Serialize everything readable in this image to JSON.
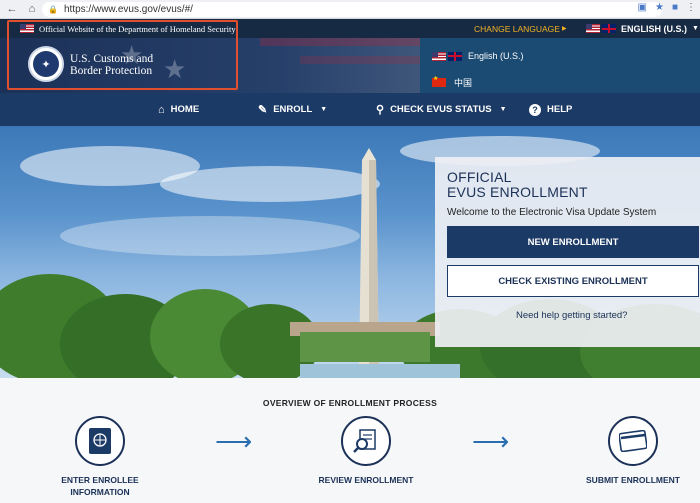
{
  "browser": {
    "url": "https://www.evus.gov/evus/#/",
    "back_icon": "back-arrow-icon",
    "home_icon": "home-icon"
  },
  "gov_strip": {
    "official_text": "Official Website of the Department of Homeland Security",
    "change_language": "CHANGE LANGUAGE",
    "selected_language": "ENGLISH (U.S.)"
  },
  "header": {
    "agency_line1": "U.S. Customs and",
    "agency_line2": "Border Protection"
  },
  "language_dropdown": {
    "options": [
      "English (U.S.)",
      "中国"
    ]
  },
  "nav": {
    "items": [
      {
        "label": "HOME",
        "icon": "home-icon"
      },
      {
        "label": "ENROLL",
        "icon": "edit-icon"
      },
      {
        "label": "CHECK EVUS STATUS",
        "icon": "search-icon"
      },
      {
        "label": "HELP",
        "icon": "help-icon"
      }
    ]
  },
  "enroll_panel": {
    "title_line1": "OFFICIAL",
    "title_line2": "EVUS ENROLLMENT",
    "subtitle": "Welcome to the Electronic Visa Update System",
    "new_button": "NEW ENROLLMENT",
    "check_button": "CHECK EXISTING ENROLLMENT",
    "help_link": "Need help getting started?"
  },
  "process": {
    "title": "OVERVIEW OF ENROLLMENT PROCESS",
    "steps": [
      {
        "label_line1": "ENTER ENROLLEE",
        "label_line2": "INFORMATION",
        "icon": "passport-icon"
      },
      {
        "label_line1": "REVIEW ENROLLMENT",
        "label_line2": "",
        "icon": "document-search-icon"
      },
      {
        "label_line1": "SUBMIT ENROLLMENT",
        "label_line2": "",
        "icon": "credit-card-icon"
      }
    ]
  },
  "colors": {
    "navy": "#1c3a66",
    "gold": "#f0b323",
    "highlight": "#e0502e",
    "accent_blue": "#2a6eb0"
  }
}
